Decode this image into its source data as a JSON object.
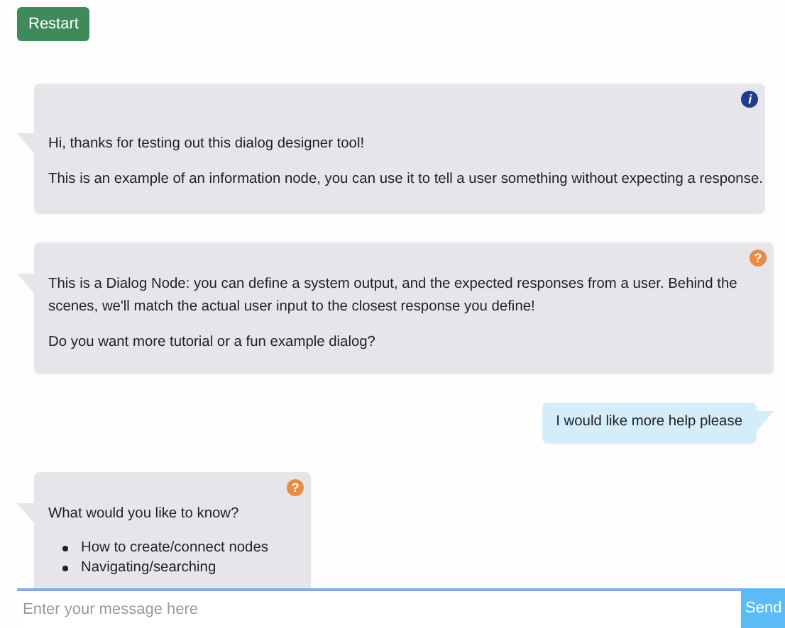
{
  "restart_button": "Restart",
  "messages": [
    {
      "kind": "info",
      "icon": "i",
      "paragraphs": [
        "Hi, thanks for testing out this dialog designer tool!",
        "This is an example of an information node, you can use it to tell a user something without expecting a response."
      ]
    },
    {
      "kind": "dialog",
      "icon": "?",
      "paragraphs": [
        "This is a Dialog Node: you can define a system output, and the expected responses from a user. Behind the scenes, we'll match the actual user input to the closest response you define!",
        "Do you want more tutorial or a fun example dialog?"
      ]
    },
    {
      "kind": "user",
      "paragraphs": [
        "I would like more help please"
      ]
    },
    {
      "kind": "dialog",
      "icon": "?",
      "paragraphs": [
        "What would you like to know?"
      ],
      "options": [
        "How to create/connect nodes",
        "Navigating/searching"
      ]
    }
  ],
  "message_input": {
    "placeholder": "Enter your message here"
  },
  "send_button": "Send"
}
